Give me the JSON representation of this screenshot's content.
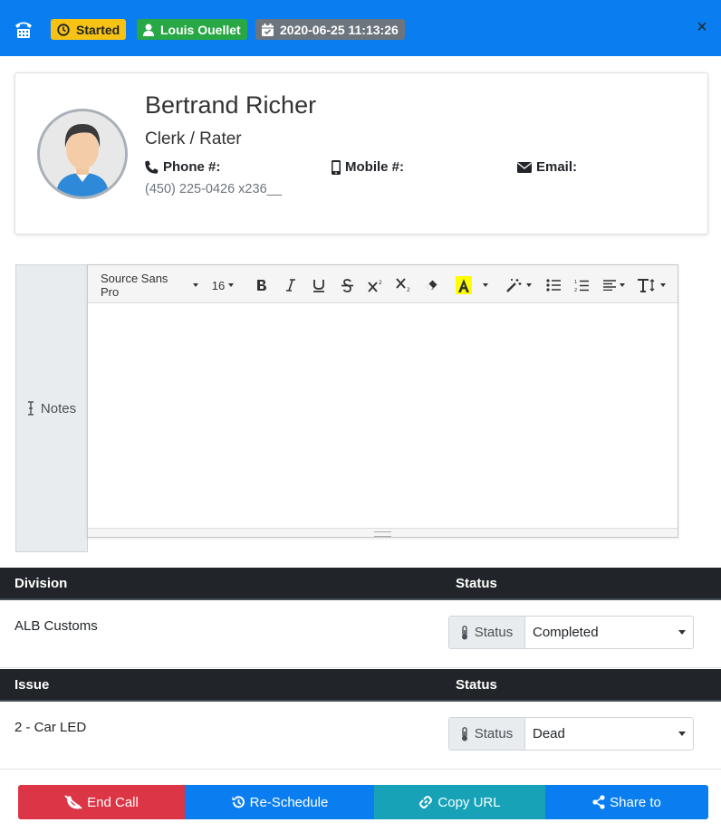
{
  "header": {
    "phone_icon": "phone-icon",
    "status_badge": "Started",
    "user_badge": "Louis Ouellet",
    "date_badge": "2020-06-25 11:13:26",
    "close_label": "×",
    "colors": {
      "bar": "#0a7ef0",
      "started": "#f6c315",
      "user": "#28a745",
      "date": "#6c757d"
    }
  },
  "contact": {
    "name": "Bertrand Richer",
    "role": "Clerk / Rater",
    "phone_label": "Phone #:",
    "mobile_label": "Mobile #:",
    "email_label": "Email:",
    "phone_value": "(450) 225-0426 x236__"
  },
  "notes": {
    "label": "Notes",
    "toolbar": {
      "font_family": "Source Sans Pro",
      "font_size": "16",
      "buttons": [
        "bold",
        "italic",
        "underline",
        "strikethrough",
        "superscript",
        "subscript",
        "eraser",
        "highlight-color",
        "magic",
        "unordered-list",
        "ordered-list",
        "align",
        "text-height"
      ]
    },
    "content": ""
  },
  "divisions": {
    "col1": "Division",
    "col2": "Status",
    "rows": [
      {
        "name": "ALB Customs",
        "status_label": "Status",
        "status_value": "Completed"
      }
    ]
  },
  "issues": {
    "col1": "Issue",
    "col2": "Status",
    "rows": [
      {
        "name": "2 - Car LED",
        "status_label": "Status",
        "status_value": "Dead"
      }
    ]
  },
  "actions": {
    "end_call": "End Call",
    "reschedule": "Re-Schedule",
    "copy_url": "Copy URL",
    "share_to": "Share to",
    "colors": {
      "end": "#dc3545",
      "reschedule": "#0a7ef0",
      "copy": "#17a2b8",
      "share": "#0a7ef0"
    }
  }
}
